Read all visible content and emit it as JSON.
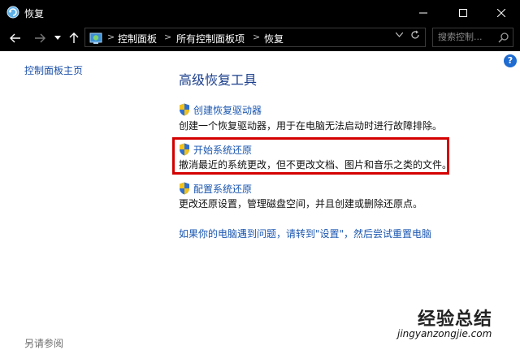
{
  "window": {
    "title": "恢复",
    "icons": {
      "app": "recovery-icon",
      "minimize": "minimize-icon",
      "maximize": "maximize-icon",
      "close": "close-icon"
    }
  },
  "nav": {
    "icons": {
      "back": "arrow-left-icon",
      "forward": "arrow-right-icon",
      "recent": "chevron-down-icon",
      "up": "arrow-up-icon"
    }
  },
  "address": {
    "crumbs": [
      "控制面板",
      "所有控制面板项",
      "恢复"
    ],
    "separator": ">",
    "icons": {
      "location": "control-panel-icon",
      "dropdown": "chevron-down-icon",
      "refresh": "refresh-icon"
    }
  },
  "search": {
    "placeholder": "搜索控制...",
    "icon": "search-icon"
  },
  "help": {
    "label": "?"
  },
  "left": {
    "home_link": "控制面板主页",
    "see_also": "另请参阅"
  },
  "main": {
    "heading": "高级恢复工具",
    "tasks": [
      {
        "label": "创建恢复驱动器",
        "desc": "创建一个恢复驱动器，用于在电脑无法启动时进行故障排除。",
        "icon": "uac-shield-icon"
      },
      {
        "label": "开始系统还原",
        "desc": "撤消最近的系统更改，但不更改文档、图片和音乐之类的文件。",
        "icon": "uac-shield-icon"
      },
      {
        "label": "配置系统还原",
        "desc": "更改还原设置，管理磁盘空间，并且创建或删除还原点。",
        "icon": "uac-shield-icon"
      }
    ],
    "reset_link": "如果你的电脑遇到问题，请转到\"设置\"，然后尝试重置电脑"
  },
  "watermark": {
    "logo": "经验总结",
    "url": "jingyanzongjie.com"
  },
  "colors": {
    "titlebar": "#000000",
    "link": "#1a56b0",
    "heading": "#1a3e8c",
    "highlight": "#d40000"
  }
}
